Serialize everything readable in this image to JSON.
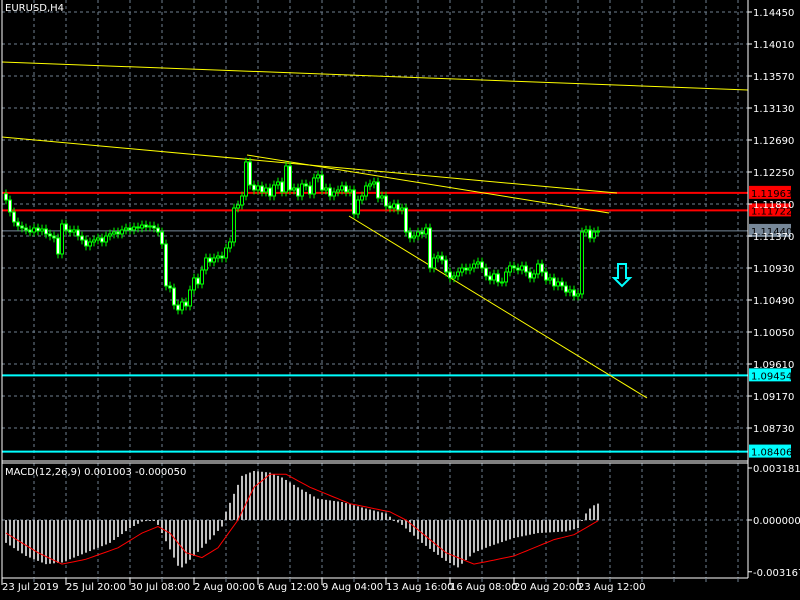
{
  "window": {
    "title": "EURUSD,H4"
  },
  "colors": {
    "background": "#000000",
    "bull_candle": "#00ff00",
    "grid": "#708090",
    "resistance": "#ff0000",
    "support": "#00ffff",
    "trendline": "#ffff00",
    "current_price": "#778899",
    "histogram": "#c0c0c0",
    "signal": "#ff0000"
  },
  "chart_data": [
    {
      "type": "candlestick",
      "symbol": "EURUSD",
      "timeframe": "H4",
      "ylim": [
        1.0825,
        1.1465
      ],
      "grid": true,
      "price_ticks": [
        "1.14450",
        "1.14010",
        "1.13570",
        "1.13130",
        "1.12690",
        "1.12250",
        "1.11810",
        "1.11370",
        "1.10930",
        "1.10490",
        "1.10050",
        "1.09610",
        "1.09170",
        "1.08730"
      ],
      "time_labels": [
        "23 Jul 2019",
        "25 Jul 20:00",
        "30 Jul 08:00",
        "2 Aug 00:00",
        "6 Aug 12:00",
        "9 Aug 04:00",
        "13 Aug 16:00",
        "16 Aug 08:00",
        "20 Aug 20:00",
        "23 Aug 12:00"
      ],
      "first_open": 1.1195,
      "closes": [
        1.11865,
        1.117,
        1.11563,
        1.11508,
        1.1148,
        1.11453,
        1.11425,
        1.1148,
        1.11439,
        1.11466,
        1.11398,
        1.1137,
        1.11343,
        1.11123,
        1.11535,
        1.11453,
        1.11425,
        1.11453,
        1.1137,
        1.11315,
        1.11233,
        1.11288,
        1.11315,
        1.11343,
        1.11288,
        1.1137,
        1.11398,
        1.11425,
        1.11398,
        1.11453,
        1.1148,
        1.11453,
        1.11494,
        1.1148,
        1.11521,
        1.11494,
        1.11508,
        1.1148,
        1.11425,
        1.1126,
        1.10683,
        1.10655,
        1.10421,
        1.10353,
        1.10463,
        1.10408,
        1.10628,
        1.10793,
        1.1071,
        1.10903,
        1.11068,
        1.11013,
        1.11068,
        1.11095,
        1.11068,
        1.11205,
        1.11288,
        1.11755,
        1.11796,
        1.1192,
        1.12388,
        1.12071,
        1.12003,
        1.12058,
        1.11975,
        1.1203,
        1.1192,
        1.12071,
        1.12113,
        1.11975,
        1.12333,
        1.12003,
        1.1203,
        1.1192,
        1.12085,
        1.12058,
        1.11948,
        1.12168,
        1.12209,
        1.12003,
        1.1203,
        1.1192,
        1.11975,
        1.12003,
        1.12058,
        1.11975,
        1.12003,
        1.11673,
        1.11865,
        1.1192,
        1.12058,
        1.12085,
        1.12113,
        1.11893,
        1.1192,
        1.11783,
        1.11755,
        1.1181,
        1.11728,
        1.11755,
        1.11425,
        1.11343,
        1.1137,
        1.11425,
        1.11398,
        1.1148,
        1.1093,
        1.11068,
        1.11095,
        1.1104,
        1.10875,
        1.10793,
        1.1082,
        1.10875,
        1.1093,
        1.10903,
        1.1093,
        1.10985,
        1.11013,
        1.1093,
        1.1082,
        1.10765,
        1.10848,
        1.10738,
        1.10738,
        1.10875,
        1.10958,
        1.1093,
        1.10903,
        1.10958,
        1.10875,
        1.10793,
        1.10848,
        1.10985,
        1.10875,
        1.10765,
        1.10793,
        1.10683,
        1.10738,
        1.10683,
        1.106,
        1.10628,
        1.10545,
        1.10573,
        1.11425,
        1.11453,
        1.11343,
        1.11425,
        1.1144
      ],
      "horizontal_lines": [
        {
          "price": 1.11963,
          "label": "1.11963",
          "kind": "resistance"
        },
        {
          "price": 1.11722,
          "label": "1.11722",
          "kind": "resistance"
        },
        {
          "price": 1.1144,
          "label": "1.11440",
          "kind": "current_price"
        },
        {
          "price": 1.09454,
          "label": "1.09454",
          "kind": "support"
        },
        {
          "price": 1.08406,
          "label": "1.08406",
          "kind": "support"
        }
      ],
      "trendlines": [
        {
          "from": {
            "bar": -1,
            "price": 1.13763
          },
          "to": {
            "bar": 186,
            "price": 1.13378
          }
        },
        {
          "from": {
            "bar": -1,
            "price": 1.12731
          },
          "to": {
            "bar": 152.75,
            "price": 1.11961
          }
        },
        {
          "from": {
            "bar": 60.25,
            "price": 1.12484
          },
          "to": {
            "bar": 150.75,
            "price": 1.11686
          }
        },
        {
          "from": {
            "bar": 85.75,
            "price": 1.11645
          },
          "to": {
            "bar": 160.25,
            "price": 1.09143
          }
        }
      ],
      "sell_arrow": {
        "icon": "arrow-down-icon",
        "bar": 154,
        "price": 1.1082
      }
    },
    {
      "type": "bar",
      "title": "MACD(12,26,9) 0.001003 -0.000050",
      "ylim": [
        -0.003167,
        0.003181
      ],
      "axis_labels": [
        "0.003181",
        "0.000000",
        "-0.003167"
      ],
      "histogram_keypoints": [
        [
          0,
          -0.0014
        ],
        [
          5,
          -0.0022
        ],
        [
          10,
          -0.0027
        ],
        [
          14,
          -0.0026
        ],
        [
          20,
          -0.002
        ],
        [
          26,
          -0.0014
        ],
        [
          31,
          -0.0005
        ],
        [
          34,
          -0.0001
        ],
        [
          37,
          0.0
        ],
        [
          38,
          -0.0003
        ],
        [
          41,
          -0.0018
        ],
        [
          43,
          -0.0028
        ],
        [
          44,
          -0.0029
        ],
        [
          47,
          -0.0022
        ],
        [
          51,
          -0.0012
        ],
        [
          54,
          -0.0004
        ],
        [
          55,
          0.0005
        ],
        [
          57,
          0.0016
        ],
        [
          59,
          0.0027
        ],
        [
          62,
          0.003
        ],
        [
          66,
          0.0029
        ],
        [
          69,
          0.0026
        ],
        [
          73,
          0.002
        ],
        [
          78,
          0.0013
        ],
        [
          84,
          0.0011
        ],
        [
          90,
          0.0007
        ],
        [
          95,
          0.0004
        ],
        [
          97,
          0.0
        ],
        [
          99,
          -0.0003
        ],
        [
          104,
          -0.0014
        ],
        [
          110,
          -0.0025
        ],
        [
          113,
          -0.0029
        ],
        [
          117,
          -0.002
        ],
        [
          121,
          -0.0016
        ],
        [
          127,
          -0.0011
        ],
        [
          133,
          -0.0008
        ],
        [
          140,
          -0.0007
        ],
        [
          143,
          -0.0005
        ],
        [
          144,
          0.0
        ],
        [
          145,
          0.0004
        ],
        [
          146,
          0.0007
        ],
        [
          147,
          0.0009
        ],
        [
          148,
          0.001003
        ]
      ],
      "signal_keypoints": [
        [
          0,
          -0.0008
        ],
        [
          8,
          -0.002
        ],
        [
          14,
          -0.0027
        ],
        [
          20,
          -0.0024
        ],
        [
          28,
          -0.0017
        ],
        [
          34,
          -0.0008
        ],
        [
          38,
          -0.0004
        ],
        [
          41,
          -0.0008
        ],
        [
          45,
          -0.002
        ],
        [
          49,
          -0.0023
        ],
        [
          53,
          -0.0017
        ],
        [
          58,
          0.0
        ],
        [
          62,
          0.002
        ],
        [
          66,
          0.0028
        ],
        [
          70,
          0.0028
        ],
        [
          76,
          0.002
        ],
        [
          86,
          0.001
        ],
        [
          96,
          0.0005
        ],
        [
          100,
          0.0
        ],
        [
          110,
          -0.002
        ],
        [
          117,
          -0.0027
        ],
        [
          127,
          -0.0022
        ],
        [
          137,
          -0.0012
        ],
        [
          142,
          -0.0009
        ],
        [
          148,
          -5e-05
        ]
      ]
    }
  ]
}
